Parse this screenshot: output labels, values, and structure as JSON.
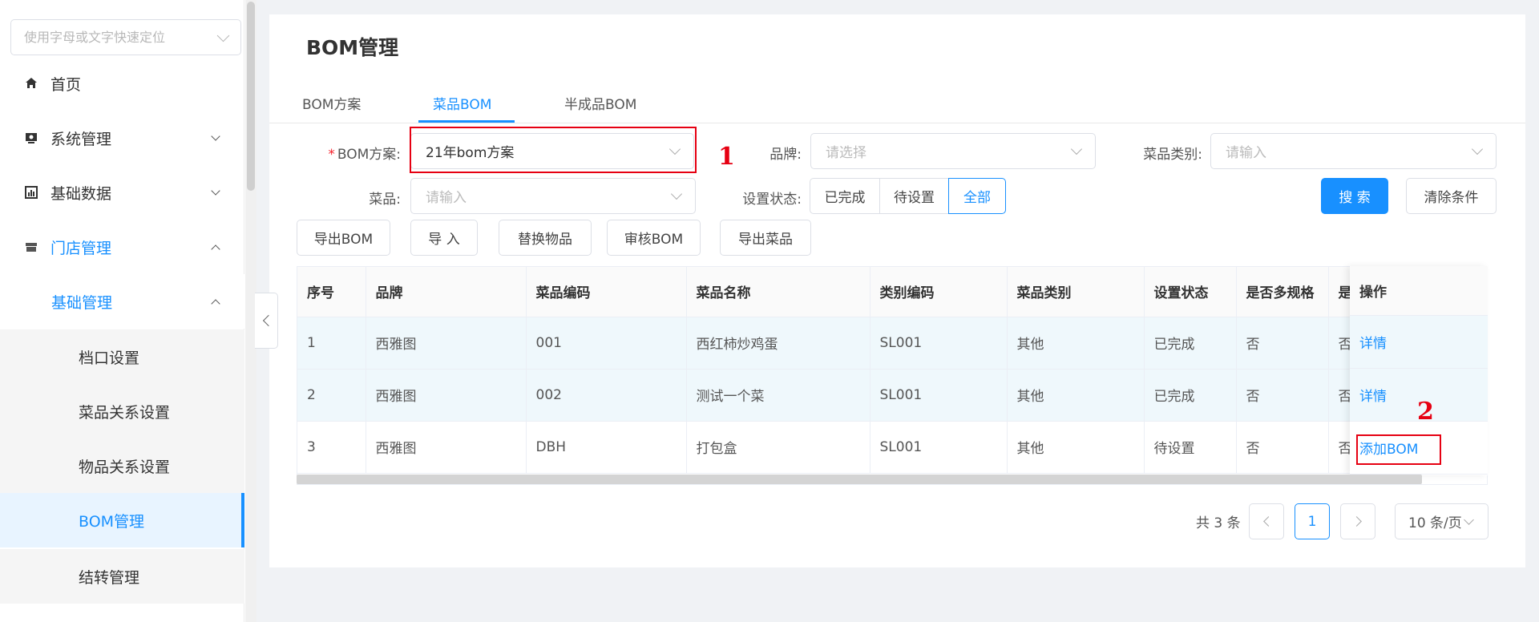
{
  "sidebar": {
    "search_placeholder": "使用字母或文字快速定位",
    "items": [
      {
        "label": "首页"
      },
      {
        "label": "系统管理"
      },
      {
        "label": "基础数据"
      },
      {
        "label": "门店管理"
      },
      {
        "label": "基础管理"
      },
      {
        "label": "档口设置"
      },
      {
        "label": "菜品关系设置"
      },
      {
        "label": "物品关系设置"
      },
      {
        "label": "BOM管理"
      },
      {
        "label": "结转管理"
      }
    ]
  },
  "page": {
    "title": "BOM管理",
    "tabs": [
      {
        "label": "BOM方案"
      },
      {
        "label": "菜品BOM"
      },
      {
        "label": "半成品BOM"
      }
    ]
  },
  "form": {
    "bom_label": "BOM方案:",
    "bom_required": "*",
    "bom_value": "21年bom方案",
    "brand_label": "品牌:",
    "brand_placeholder": "请选择",
    "category_label": "菜品类别:",
    "category_placeholder": "请输入",
    "dish_label": "菜品:",
    "dish_placeholder": "请输入",
    "status_label": "设置状态:",
    "status_options": [
      "已完成",
      "待设置",
      "全部"
    ],
    "status_selected": "全部",
    "search_button": "搜 索",
    "clear_button": "清除条件"
  },
  "toolbar": {
    "buttons": [
      "导出BOM",
      "导 入",
      "替换物品",
      "审核BOM",
      "导出菜品"
    ]
  },
  "table": {
    "headers": [
      "序号",
      "品牌",
      "菜品编码",
      "菜品名称",
      "类别编码",
      "菜品类别",
      "设置状态",
      "是否多规格",
      "是",
      "操作"
    ],
    "rows": [
      [
        "1",
        "西雅图",
        "001",
        "西红柿炒鸡蛋",
        "SL001",
        "其他",
        "已完成",
        "否",
        "否",
        "详情"
      ],
      [
        "2",
        "西雅图",
        "002",
        "测试一个菜",
        "SL001",
        "其他",
        "已完成",
        "否",
        "否",
        "详情"
      ],
      [
        "3",
        "西雅图",
        "DBH",
        "打包盒",
        "SL001",
        "其他",
        "待设置",
        "否",
        "否",
        "添加BOM"
      ]
    ]
  },
  "pagination": {
    "total_text": "共 3 条",
    "current_page": "1",
    "page_size": "10 条/页"
  },
  "annotations": {
    "marker_1": "1",
    "marker_2": "2",
    "color": "#e60012"
  },
  "colors": {
    "primary": "#1890ff",
    "annotation_red": "#e60012",
    "row_tint": "#eff8fc"
  }
}
